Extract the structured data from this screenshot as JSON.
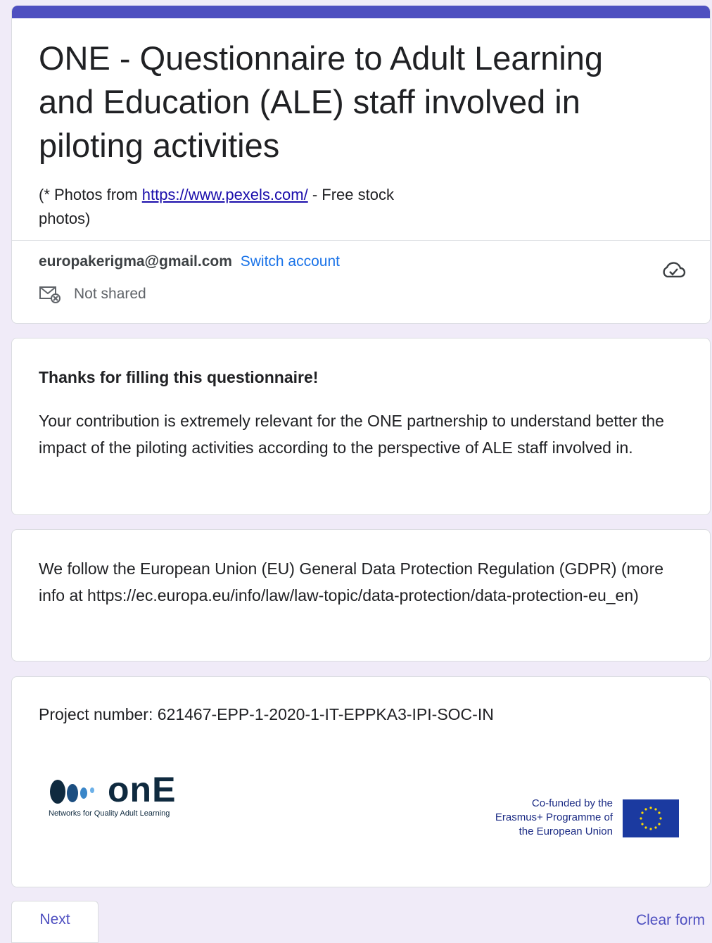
{
  "header": {
    "title": "ONE - Questionnaire to Adult Learning and Education (ALE) staff involved in piloting activities",
    "subtitle_prefix": "(* Photos from",
    "subtitle_link": "https://www.pexels.com/",
    "subtitle_suffix": " - Free stock photos)",
    "accent_color": "#4e4fc0"
  },
  "account": {
    "email": "europakerigma@gmail.com",
    "switch_label": "Switch account",
    "shared_label": "Not shared"
  },
  "thanks": {
    "title": "Thanks for filling this questionnaire!",
    "text": "Your contribution is extremely relevant for the ONE partnership to understand better the impact of the piloting activities according to the perspective of ALE staff involved in."
  },
  "gdpr": {
    "text": "We follow the European Union (EU) General Data Protection Regulation (GDPR) (more info at  https://ec.europa.eu/info/law/law-topic/data-protection/data-protection-eu_en)"
  },
  "project": {
    "number_text": "Project number: 621467-EPP-1-2020-1-IT-EPPKA3-IPI-SOC-IN",
    "logo_word": "onE",
    "logo_tagline": "Networks for Quality Adult Learning",
    "eu_text": "Co-funded by the Erasmus+ Programme of the European Union"
  },
  "footer": {
    "next_label": "Next",
    "clear_label": "Clear form"
  }
}
